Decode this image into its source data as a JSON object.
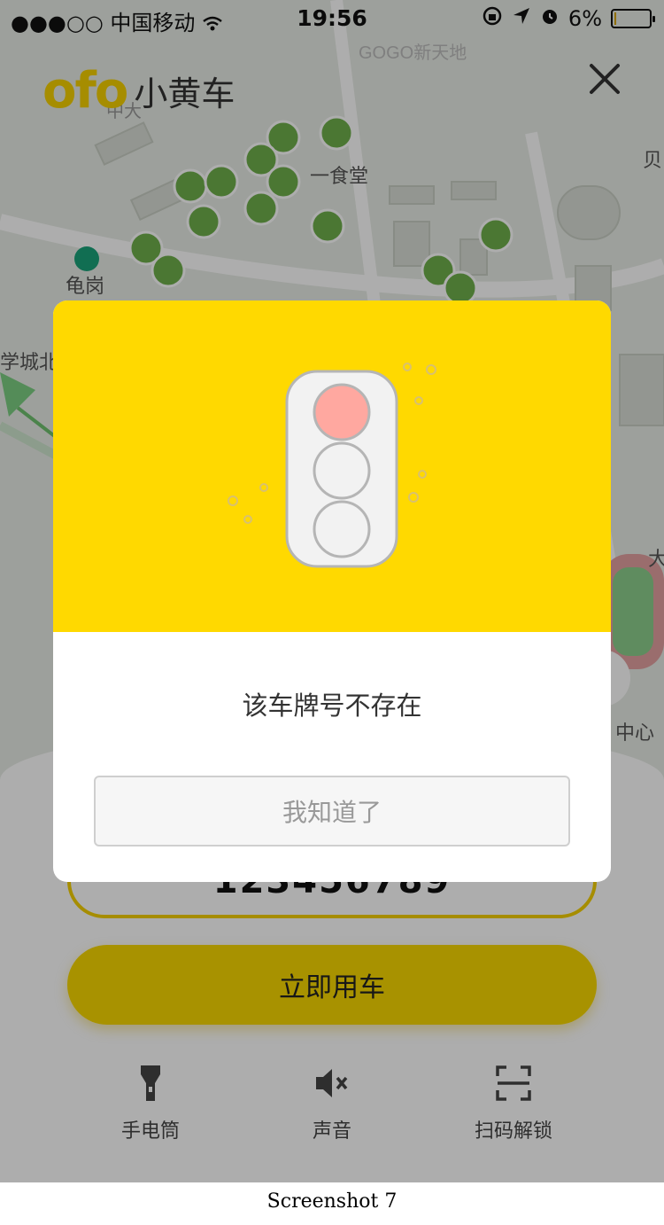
{
  "status_bar": {
    "signal": "●●●○○",
    "carrier": "中国移动",
    "time": "19:56",
    "battery_percent_label": "6%",
    "battery_level": 0.06
  },
  "header": {
    "logo_text": "ofo",
    "logo_cn": "小黄车",
    "close_icon": "close-icon"
  },
  "map": {
    "labels": [
      "GOGO新天地",
      "中大",
      "一食堂",
      "龟岗",
      "学城北",
      "贝",
      "大",
      "中心"
    ]
  },
  "plate": {
    "value": "123456789"
  },
  "primary_button": {
    "label": "立即用车"
  },
  "tools": [
    {
      "label": "手电筒",
      "icon": "flashlight-icon"
    },
    {
      "label": "声音",
      "icon": "sound-off-icon"
    },
    {
      "label": "扫码解锁",
      "icon": "scan-icon"
    }
  ],
  "dialog": {
    "message": "该车牌号不存在",
    "button_label": "我知道了",
    "illustration": "traffic-light-icon",
    "accent_color": "#ffd900"
  },
  "caption": "Screenshot 7"
}
